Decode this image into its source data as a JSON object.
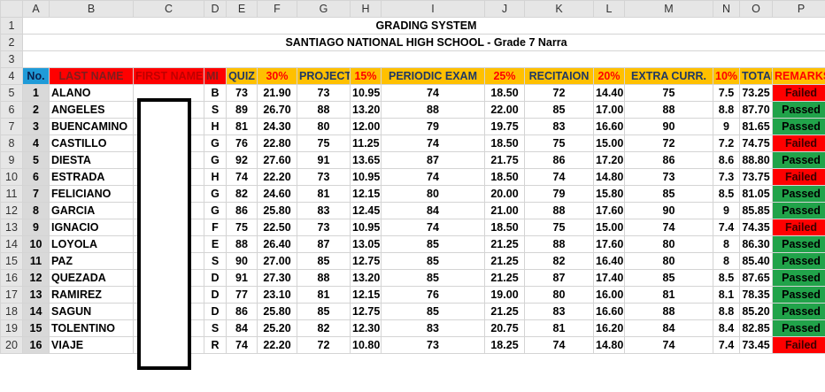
{
  "columns": [
    "A",
    "B",
    "C",
    "D",
    "E",
    "F",
    "G",
    "H",
    "I",
    "J",
    "K",
    "L",
    "M",
    "N",
    "O",
    "P"
  ],
  "title": "GRADING SYSTEM",
  "subtitle": "SANTIAGO NATIONAL HIGH SCHOOL - Grade 7 Narra",
  "headers": {
    "no": "No.",
    "last_name": "LAST NAME",
    "first_name": "FIRST NAME",
    "mi": "MI",
    "quiz": "QUIZ",
    "quiz_pct": "30%",
    "project": "PROJECT",
    "project_pct": "15%",
    "periodic_exam": "PERIODIC EXAM",
    "exam_pct": "25%",
    "recitation": "RECITAION",
    "recitation_pct": "20%",
    "extra": "EXTRA CURR.",
    "extra_pct": "10%",
    "total": "TOTAL",
    "remarks": "REMARKS"
  },
  "rows": [
    {
      "row": "5",
      "no": "1",
      "last": "ALANO",
      "mi": "B",
      "quiz": "73",
      "quizw": "21.90",
      "proj": "73",
      "projw": "10.95",
      "exam": "74",
      "examw": "18.50",
      "rec": "72",
      "recw": "14.40",
      "extra": "75",
      "extraw": "7.5",
      "total": "73.25",
      "remark": "Failed",
      "status": "failed"
    },
    {
      "row": "6",
      "no": "2",
      "last": "ANGELES",
      "mi": "S",
      "quiz": "89",
      "quizw": "26.70",
      "proj": "88",
      "projw": "13.20",
      "exam": "88",
      "examw": "22.00",
      "rec": "85",
      "recw": "17.00",
      "extra": "88",
      "extraw": "8.8",
      "total": "87.70",
      "remark": "Passed",
      "status": "passed"
    },
    {
      "row": "7",
      "no": "3",
      "last": "BUENCAMINO",
      "mi": "H",
      "quiz": "81",
      "quizw": "24.30",
      "proj": "80",
      "projw": "12.00",
      "exam": "79",
      "examw": "19.75",
      "rec": "83",
      "recw": "16.60",
      "extra": "90",
      "extraw": "9",
      "total": "81.65",
      "remark": "Passed",
      "status": "passed"
    },
    {
      "row": "8",
      "no": "4",
      "last": "CASTILLO",
      "mi": "G",
      "quiz": "76",
      "quizw": "22.80",
      "proj": "75",
      "projw": "11.25",
      "exam": "74",
      "examw": "18.50",
      "rec": "75",
      "recw": "15.00",
      "extra": "72",
      "extraw": "7.2",
      "total": "74.75",
      "remark": "Failed",
      "status": "failed"
    },
    {
      "row": "9",
      "no": "5",
      "last": "DIESTA",
      "mi": "G",
      "quiz": "92",
      "quizw": "27.60",
      "proj": "91",
      "projw": "13.65",
      "exam": "87",
      "examw": "21.75",
      "rec": "86",
      "recw": "17.20",
      "extra": "86",
      "extraw": "8.6",
      "total": "88.80",
      "remark": "Passed",
      "status": "passed"
    },
    {
      "row": "10",
      "no": "6",
      "last": "ESTRADA",
      "mi": "H",
      "quiz": "74",
      "quizw": "22.20",
      "proj": "73",
      "projw": "10.95",
      "exam": "74",
      "examw": "18.50",
      "rec": "74",
      "recw": "14.80",
      "extra": "73",
      "extraw": "7.3",
      "total": "73.75",
      "remark": "Failed",
      "status": "failed"
    },
    {
      "row": "11",
      "no": "7",
      "last": "FELICIANO",
      "mi": "G",
      "quiz": "82",
      "quizw": "24.60",
      "proj": "81",
      "projw": "12.15",
      "exam": "80",
      "examw": "20.00",
      "rec": "79",
      "recw": "15.80",
      "extra": "85",
      "extraw": "8.5",
      "total": "81.05",
      "remark": "Passed",
      "status": "passed"
    },
    {
      "row": "12",
      "no": "8",
      "last": "GARCIA",
      "mi": "G",
      "quiz": "86",
      "quizw": "25.80",
      "proj": "83",
      "projw": "12.45",
      "exam": "84",
      "examw": "21.00",
      "rec": "88",
      "recw": "17.60",
      "extra": "90",
      "extraw": "9",
      "total": "85.85",
      "remark": "Passed",
      "status": "passed"
    },
    {
      "row": "13",
      "no": "9",
      "last": "IGNACIO",
      "mi": "F",
      "quiz": "75",
      "quizw": "22.50",
      "proj": "73",
      "projw": "10.95",
      "exam": "74",
      "examw": "18.50",
      "rec": "75",
      "recw": "15.00",
      "extra": "74",
      "extraw": "7.4",
      "total": "74.35",
      "remark": "Failed",
      "status": "failed"
    },
    {
      "row": "14",
      "no": "10",
      "last": "LOYOLA",
      "mi": "E",
      "quiz": "88",
      "quizw": "26.40",
      "proj": "87",
      "projw": "13.05",
      "exam": "85",
      "examw": "21.25",
      "rec": "88",
      "recw": "17.60",
      "extra": "80",
      "extraw": "8",
      "total": "86.30",
      "remark": "Passed",
      "status": "passed"
    },
    {
      "row": "15",
      "no": "11",
      "last": "PAZ",
      "mi": "S",
      "quiz": "90",
      "quizw": "27.00",
      "proj": "85",
      "projw": "12.75",
      "exam": "85",
      "examw": "21.25",
      "rec": "82",
      "recw": "16.40",
      "extra": "80",
      "extraw": "8",
      "total": "85.40",
      "remark": "Passed",
      "status": "passed"
    },
    {
      "row": "16",
      "no": "12",
      "last": "QUEZADA",
      "mi": "D",
      "quiz": "91",
      "quizw": "27.30",
      "proj": "88",
      "projw": "13.20",
      "exam": "85",
      "examw": "21.25",
      "rec": "87",
      "recw": "17.40",
      "extra": "85",
      "extraw": "8.5",
      "total": "87.65",
      "remark": "Passed",
      "status": "passed"
    },
    {
      "row": "17",
      "no": "13",
      "last": "RAMIREZ",
      "mi": "D",
      "quiz": "77",
      "quizw": "23.10",
      "proj": "81",
      "projw": "12.15",
      "exam": "76",
      "examw": "19.00",
      "rec": "80",
      "recw": "16.00",
      "extra": "81",
      "extraw": "8.1",
      "total": "78.35",
      "remark": "Passed",
      "status": "passed"
    },
    {
      "row": "18",
      "no": "14",
      "last": "SAGUN",
      "mi": "D",
      "quiz": "86",
      "quizw": "25.80",
      "proj": "85",
      "projw": "12.75",
      "exam": "85",
      "examw": "21.25",
      "rec": "83",
      "recw": "16.60",
      "extra": "88",
      "extraw": "8.8",
      "total": "85.20",
      "remark": "Passed",
      "status": "passed"
    },
    {
      "row": "19",
      "no": "15",
      "last": "TOLENTINO",
      "mi": "S",
      "quiz": "84",
      "quizw": "25.20",
      "proj": "82",
      "projw": "12.30",
      "exam": "83",
      "examw": "20.75",
      "rec": "81",
      "recw": "16.20",
      "extra": "84",
      "extraw": "8.4",
      "total": "82.85",
      "remark": "Passed",
      "status": "passed"
    },
    {
      "row": "20",
      "no": "16",
      "last": "VIAJE",
      "mi": "R",
      "quiz": "74",
      "quizw": "22.20",
      "proj": "72",
      "projw": "10.80",
      "exam": "73",
      "examw": "18.25",
      "rec": "74",
      "recw": "14.80",
      "extra": "74",
      "extraw": "7.4",
      "total": "73.45",
      "remark": "Failed",
      "status": "failed"
    }
  ],
  "colors": {
    "passed": "#21a34a",
    "failed": "#ff0000",
    "header": "#ffc000",
    "no_header": "#1f9bd8"
  }
}
